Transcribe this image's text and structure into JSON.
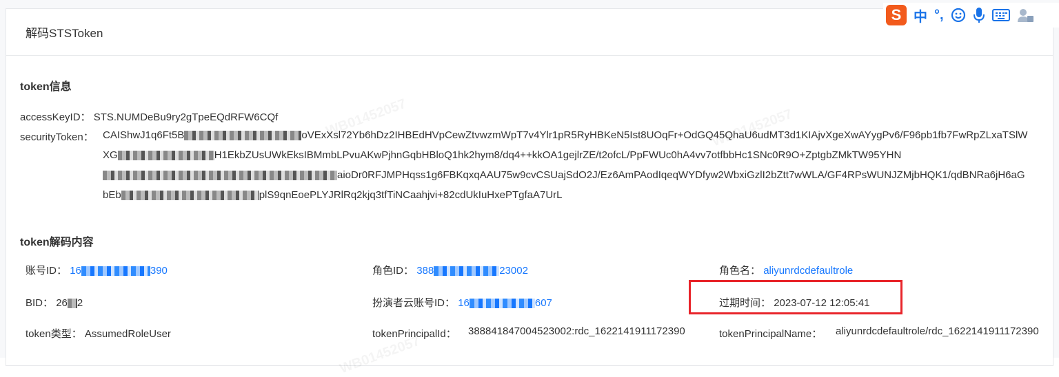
{
  "panel": {
    "title": "解码STSToken"
  },
  "token_info": {
    "section_title": "token信息",
    "access_key_label": "accessKeyID：",
    "access_key_value": "STS.NUMDeBu9ry2gTpeEQdRFW6CQf",
    "security_token_label": "securityToken：",
    "security_token_value_start": "CAIShwJ1q6Ft5B",
    "security_token_value_mid1": "oVExXsl72Yb6hDz2IHBEdHVpCewZtvwzmWpT7v4Ylr1pR5RyHBKeN5Ist8UOqFr+OdGQ45QhaU6udMT3d1KIAjvXgeXwAYygPv6/F96pb1fb7FwRpZLxaTSlWXG",
    "security_token_value_mid2": "H1EkbZUsUWkEksIBMmbLPvuAKwPjhnGqbHBloQ1hk2hym8/dq4++kkOA1gejlrZE/t2ofcL/PpFWUc0hA4vv7otfbbHc1SNc0R9O+ZptgbZMkTW95YHN",
    "security_token_value_mid3": "aioDr0RFJMPHqss1g6FBKqxqAAU75w9cvCSUajSdO2J/Ez6AmPAodIqeqWYDfyw2WbxiGzlI2bZtt7wWLA/GF4RPsWUNJZMjbHQK1/qdBNRa6jH6aGbEb",
    "security_token_value_end": "plS9qnEoePLYJRlRq2kjq3tfTiNCaahjvi+82cdUkIuHxePTgfaA7UrL"
  },
  "decoded": {
    "section_title": "token解码内容",
    "account_id_label": "账号ID：",
    "account_id_value_prefix": "16",
    "account_id_value_suffix": "390",
    "role_id_label": "角色ID：",
    "role_id_value_prefix": "388",
    "role_id_value_suffix": "23002",
    "role_name_label": "角色名：",
    "role_name_value": "aliyunrdcdefaultrole",
    "bid_label": "BID：",
    "bid_value_prefix": "26",
    "bid_value_suffix": "2",
    "impersonate_label": "扮演者云账号ID：",
    "impersonate_value_prefix": "16",
    "impersonate_value_suffix": "607",
    "expire_label": "过期时间：",
    "expire_value": "2023-07-12 12:05:41",
    "token_type_label": "token类型：",
    "token_type_value": "AssumedRoleUser",
    "principal_id_label": "tokenPrincipalId：",
    "principal_id_value": "388841847004523002:rdc_1622141911172390",
    "principal_name_label": "tokenPrincipalName：",
    "principal_name_value": "aliyunrdcdefaultrole/rdc_1622141911172390"
  },
  "watermark_text": "WB01452057",
  "ime_toolbar": {
    "logo": "S",
    "mode": "中",
    "punct": "°,",
    "icons": [
      "emoji-icon",
      "microphone-icon",
      "keyboard-icon",
      "user-icon"
    ]
  },
  "colors": {
    "link": "#1677ff",
    "highlight_border": "#e8242a",
    "ime_brand": "#f25a1c"
  }
}
